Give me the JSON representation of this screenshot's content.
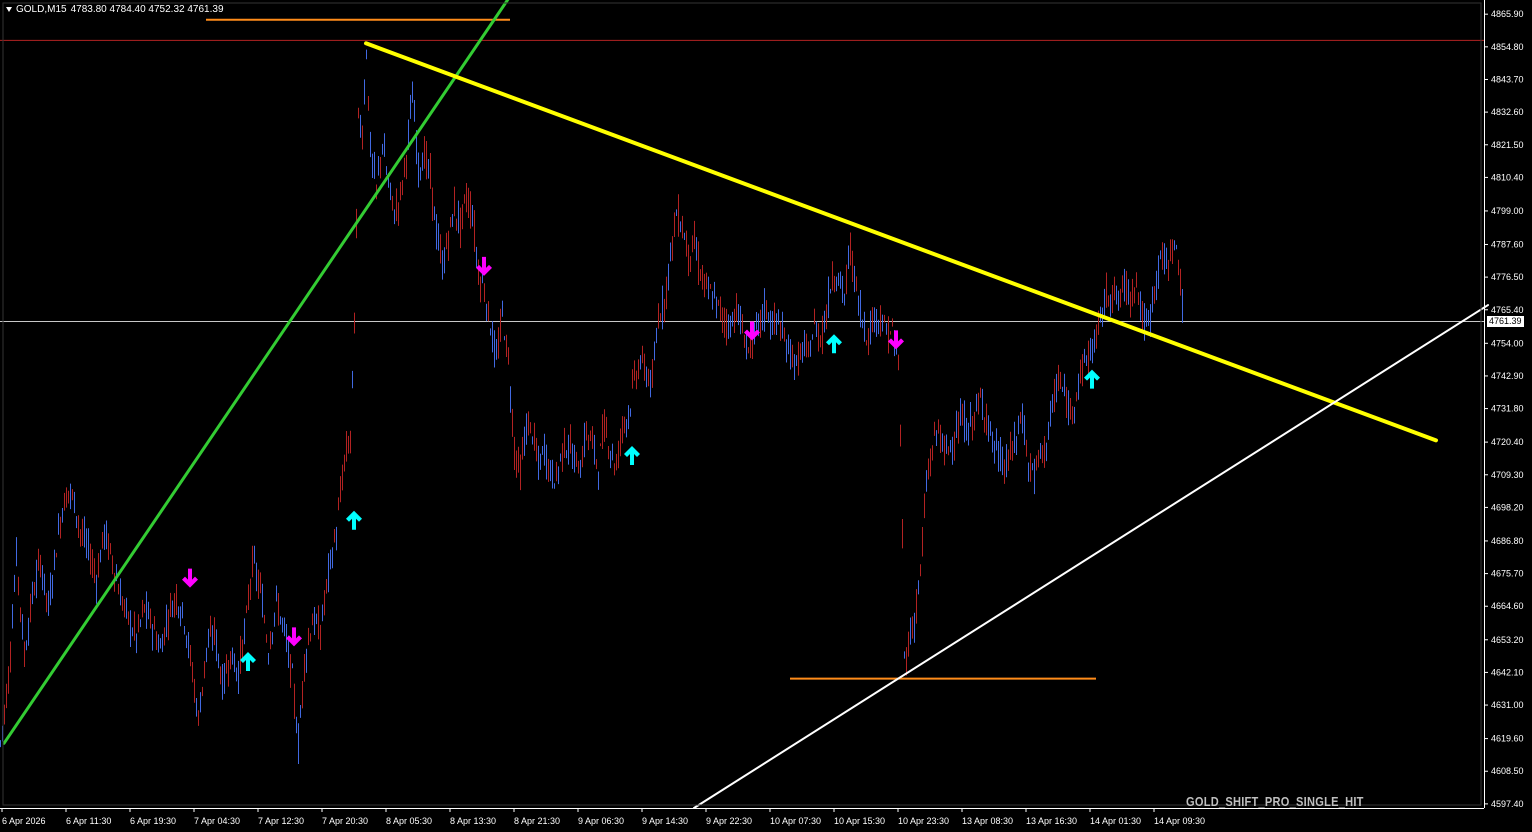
{
  "header": {
    "symbol": "GOLD,M15",
    "ohlc": "4783.80 4784.40 4752.32 4761.39"
  },
  "watermark": "GOLD_SHIFT_PRO_SINGLE_HIT",
  "current_price_label": "4761.39",
  "chart_data": {
    "type": "candlestick",
    "title": "GOLD,M15",
    "colors": {
      "background": "#000000",
      "bull": "#4169e1",
      "bear": "#b22222",
      "axis": "#ffffff",
      "buy_arrow": "#00ffff",
      "sell_arrow": "#ff00ff"
    },
    "y_ticks": [
      "4865.90",
      "4854.80",
      "4843.70",
      "4832.60",
      "4821.50",
      "4810.40",
      "4799.00",
      "4787.60",
      "4776.50",
      "4765.40",
      "4754.00",
      "4742.90",
      "4731.80",
      "4720.40",
      "4709.30",
      "4698.20",
      "4686.80",
      "4675.70",
      "4664.60",
      "4653.20",
      "4642.10",
      "4631.00",
      "4619.60",
      "4608.50",
      "4597.40"
    ],
    "ylim": [
      4596,
      4868
    ],
    "x_ticks": [
      "6 Apr 2026",
      "6 Apr 11:30",
      "6 Apr 19:30",
      "7 Apr 04:30",
      "7 Apr 12:30",
      "7 Apr 20:30",
      "8 Apr 05:30",
      "8 Apr 13:30",
      "8 Apr 21:30",
      "9 Apr 06:30",
      "9 Apr 14:30",
      "9 Apr 22:30",
      "10 Apr 07:30",
      "10 Apr 15:30",
      "10 Apr 23:30",
      "13 Apr 08:30",
      "13 Apr 16:30",
      "14 Apr 01:30",
      "14 Apr 09:30"
    ],
    "current_price": 4761.39,
    "price_path": [
      [
        0,
        4618
      ],
      [
        8,
        4640
      ],
      [
        16,
        4682
      ],
      [
        24,
        4648
      ],
      [
        32,
        4668
      ],
      [
        40,
        4680
      ],
      [
        48,
        4664
      ],
      [
        56,
        4685
      ],
      [
        62,
        4698
      ],
      [
        68,
        4704
      ],
      [
        74,
        4700
      ],
      [
        80,
        4690
      ],
      [
        88,
        4684
      ],
      [
        96,
        4674
      ],
      [
        104,
        4690
      ],
      [
        112,
        4680
      ],
      [
        120,
        4668
      ],
      [
        128,
        4660
      ],
      [
        136,
        4654
      ],
      [
        144,
        4664
      ],
      [
        152,
        4658
      ],
      [
        160,
        4650
      ],
      [
        168,
        4662
      ],
      [
        176,
        4668
      ],
      [
        184,
        4660
      ],
      [
        192,
        4642
      ],
      [
        198,
        4626
      ],
      [
        206,
        4650
      ],
      [
        214,
        4656
      ],
      [
        222,
        4638
      ],
      [
        230,
        4648
      ],
      [
        238,
        4642
      ],
      [
        246,
        4660
      ],
      [
        252,
        4680
      ],
      [
        260,
        4670
      ],
      [
        268,
        4650
      ],
      [
        276,
        4666
      ],
      [
        284,
        4656
      ],
      [
        292,
        4640
      ],
      [
        298,
        4618
      ],
      [
        304,
        4646
      ],
      [
        312,
        4660
      ],
      [
        320,
        4656
      ],
      [
        328,
        4676
      ],
      [
        336,
        4690
      ],
      [
        344,
        4714
      ],
      [
        350,
        4722
      ],
      [
        354,
        4760
      ],
      [
        358,
        4830
      ],
      [
        362,
        4826
      ],
      [
        366,
        4854
      ],
      [
        370,
        4820
      ],
      [
        376,
        4806
      ],
      [
        382,
        4822
      ],
      [
        388,
        4808
      ],
      [
        394,
        4798
      ],
      [
        400,
        4804
      ],
      [
        406,
        4818
      ],
      [
        412,
        4838
      ],
      [
        418,
        4814
      ],
      [
        424,
        4818
      ],
      [
        430,
        4810
      ],
      [
        436,
        4792
      ],
      [
        442,
        4780
      ],
      [
        448,
        4790
      ],
      [
        454,
        4800
      ],
      [
        460,
        4794
      ],
      [
        466,
        4804
      ],
      [
        472,
        4798
      ],
      [
        478,
        4778
      ],
      [
        484,
        4772
      ],
      [
        490,
        4760
      ],
      [
        496,
        4748
      ],
      [
        502,
        4764
      ],
      [
        508,
        4748
      ],
      [
        514,
        4718
      ],
      [
        520,
        4710
      ],
      [
        526,
        4726
      ],
      [
        532,
        4724
      ],
      [
        538,
        4712
      ],
      [
        544,
        4718
      ],
      [
        550,
        4710
      ],
      [
        556,
        4708
      ],
      [
        562,
        4718
      ],
      [
        568,
        4720
      ],
      [
        574,
        4714
      ],
      [
        580,
        4712
      ],
      [
        586,
        4724
      ],
      [
        592,
        4720
      ],
      [
        598,
        4712
      ],
      [
        604,
        4726
      ],
      [
        610,
        4718
      ],
      [
        616,
        4712
      ],
      [
        622,
        4726
      ],
      [
        628,
        4730
      ],
      [
        634,
        4742
      ],
      [
        640,
        4748
      ],
      [
        646,
        4744
      ],
      [
        652,
        4740
      ],
      [
        658,
        4764
      ],
      [
        664,
        4768
      ],
      [
        670,
        4784
      ],
      [
        676,
        4798
      ],
      [
        682,
        4794
      ],
      [
        688,
        4784
      ],
      [
        694,
        4788
      ],
      [
        700,
        4778
      ],
      [
        706,
        4772
      ],
      [
        712,
        4770
      ],
      [
        718,
        4766
      ],
      [
        724,
        4762
      ],
      [
        730,
        4760
      ],
      [
        736,
        4766
      ],
      [
        742,
        4758
      ],
      [
        748,
        4752
      ],
      [
        754,
        4756
      ],
      [
        760,
        4762
      ],
      [
        766,
        4766
      ],
      [
        772,
        4760
      ],
      [
        778,
        4762
      ],
      [
        784,
        4754
      ],
      [
        790,
        4752
      ],
      [
        796,
        4746
      ],
      [
        802,
        4752
      ],
      [
        808,
        4750
      ],
      [
        814,
        4760
      ],
      [
        820,
        4756
      ],
      [
        826,
        4764
      ],
      [
        832,
        4778
      ],
      [
        838,
        4776
      ],
      [
        844,
        4770
      ],
      [
        850,
        4786
      ],
      [
        856,
        4772
      ],
      [
        862,
        4762
      ],
      [
        868,
        4756
      ],
      [
        874,
        4764
      ],
      [
        880,
        4762
      ],
      [
        886,
        4758
      ],
      [
        892,
        4758
      ],
      [
        898,
        4748
      ],
      [
        902,
        4690
      ],
      [
        904,
        4646
      ],
      [
        908,
        4652
      ],
      [
        914,
        4660
      ],
      [
        920,
        4676
      ],
      [
        926,
        4706
      ],
      [
        932,
        4718
      ],
      [
        938,
        4726
      ],
      [
        944,
        4716
      ],
      [
        950,
        4720
      ],
      [
        956,
        4724
      ],
      [
        962,
        4728
      ],
      [
        968,
        4724
      ],
      [
        974,
        4730
      ],
      [
        980,
        4734
      ],
      [
        986,
        4730
      ],
      [
        992,
        4720
      ],
      [
        998,
        4716
      ],
      [
        1004,
        4712
      ],
      [
        1010,
        4716
      ],
      [
        1016,
        4722
      ],
      [
        1022,
        4730
      ],
      [
        1028,
        4712
      ],
      [
        1034,
        4710
      ],
      [
        1040,
        4716
      ],
      [
        1046,
        4720
      ],
      [
        1052,
        4732
      ],
      [
        1058,
        4742
      ],
      [
        1064,
        4736
      ],
      [
        1070,
        4730
      ],
      [
        1076,
        4738
      ],
      [
        1082,
        4746
      ],
      [
        1088,
        4750
      ],
      [
        1094,
        4754
      ],
      [
        1100,
        4762
      ],
      [
        1106,
        4770
      ],
      [
        1112,
        4772
      ],
      [
        1118,
        4768
      ],
      [
        1124,
        4774
      ],
      [
        1130,
        4770
      ],
      [
        1136,
        4776
      ],
      [
        1142,
        4762
      ],
      [
        1148,
        4760
      ],
      [
        1154,
        4772
      ],
      [
        1160,
        4784
      ],
      [
        1166,
        4780
      ],
      [
        1172,
        4788
      ],
      [
        1178,
        4782
      ],
      [
        1184,
        4762
      ]
    ],
    "series": [
      {
        "name": "trend_green",
        "color": "#33cc33",
        "points": [
          [
            4,
            4618
          ],
          [
            526,
            4880
          ]
        ]
      },
      {
        "name": "trend_yellow",
        "color": "#ffff00",
        "points": [
          [
            366,
            4856
          ],
          [
            1436,
            4721
          ]
        ]
      },
      {
        "name": "trend_white",
        "color": "#ffffff",
        "points": [
          [
            694,
            4596
          ],
          [
            1488,
            4767
          ]
        ]
      },
      {
        "name": "level_red",
        "color": "#b22222",
        "price": 4857
      },
      {
        "name": "level_orange_top",
        "color": "#ff8c1a",
        "price": 4864,
        "from": 206,
        "to": 510
      },
      {
        "name": "level_orange_bottom",
        "color": "#ff8c1a",
        "price": 4640,
        "from": 790,
        "to": 1096
      }
    ],
    "buy_arrows": [
      [
        354,
        4694
      ],
      [
        248,
        4646
      ],
      [
        632,
        4716
      ],
      [
        834,
        4754
      ],
      [
        1092,
        4742
      ]
    ],
    "sell_arrows": [
      [
        190,
        4674
      ],
      [
        294,
        4654
      ],
      [
        484,
        4780
      ],
      [
        752,
        4758
      ],
      [
        896,
        4755
      ]
    ]
  }
}
